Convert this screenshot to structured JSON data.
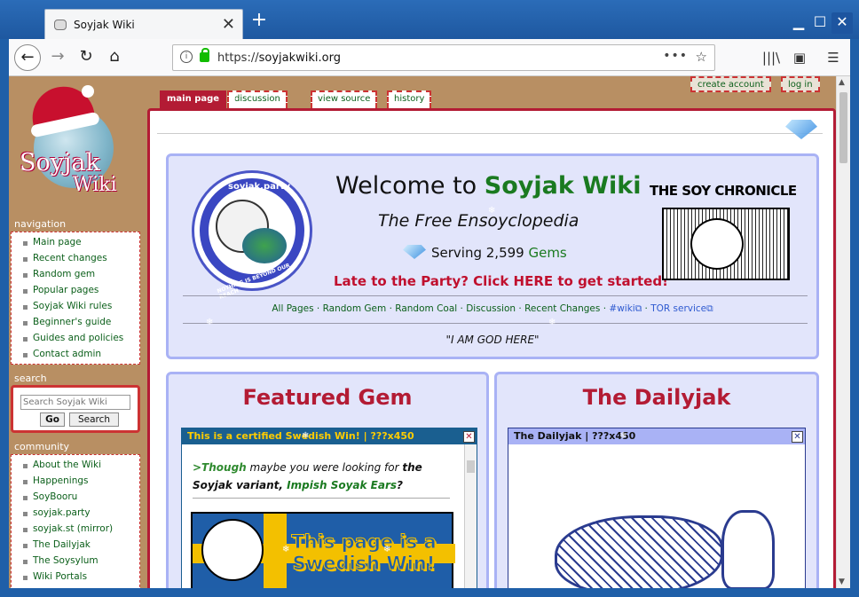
{
  "browser": {
    "tab_title": "Soyjak Wiki",
    "url_scheme": "https://",
    "url_host": "soyjakwiki.org",
    "new_tab": "+",
    "tab_close": "✕"
  },
  "wiki": {
    "logo_word1": "Soyjak",
    "logo_word2": "Wiki",
    "tabs": {
      "main": "main page",
      "discussion": "discussion",
      "source": "view source",
      "history": "history"
    },
    "personal": {
      "create": "create account",
      "login": "log in"
    },
    "navigation": {
      "heading": "navigation",
      "items": [
        "Main page",
        "Recent changes",
        "Random gem",
        "Popular pages",
        "Soyjak Wiki rules",
        "Beginner's guide",
        "Guides and policies",
        "Contact admin"
      ]
    },
    "search": {
      "heading": "search",
      "placeholder": "Search Soyjak Wiki",
      "go": "Go",
      "search": "Search"
    },
    "community": {
      "heading": "community",
      "items": [
        "About the Wiki",
        "Happenings",
        "SoyBooru",
        "soyjak.party",
        "soyjak.st (mirror)",
        "The Dailyjak",
        "The Soysylum",
        "Wiki Portals"
      ]
    }
  },
  "welcome": {
    "title_prefix": "Welcome to ",
    "title_highlight": "Soyjak Wiki",
    "subtitle": "The Free Ensoyclopedia",
    "serving_prefix": "Serving 2,599 ",
    "serving_gems": "Gems",
    "cta": "Late to the Party? Click HERE to get started!",
    "chronicle": "THE SOY CHRONICLE",
    "logo_top": "soyjak.party",
    "logo_bottom": "NOTHING IS BEYOND OUR REACH",
    "links": [
      "All Pages",
      "Random Gem",
      "Random Coal",
      "Discussion",
      "Recent Changes",
      "#wiki",
      "TOR service"
    ],
    "quote": "\"I AM GOD HERE\""
  },
  "featured": {
    "title": "Featured Gem",
    "box_head": "This is a certified Swedish Win! | ???x450",
    "text_green": ">Though",
    "text_mid": " maybe you were looking for ",
    "text_the": "the",
    "text_variant": "Soyjak variant, ",
    "text_link": "Impish Soyak Ears",
    "text_q": "?",
    "banner": "This page is a Swedish Win!"
  },
  "dailyjak": {
    "title": "The Dailyjak",
    "box_head": "The Dailyjak | ???x450"
  },
  "colors": {
    "accent_red": "#b31b34",
    "link_green": "#0b5f1a",
    "panel_bg": "#e2e5fb",
    "panel_border": "#a9b2f5"
  }
}
